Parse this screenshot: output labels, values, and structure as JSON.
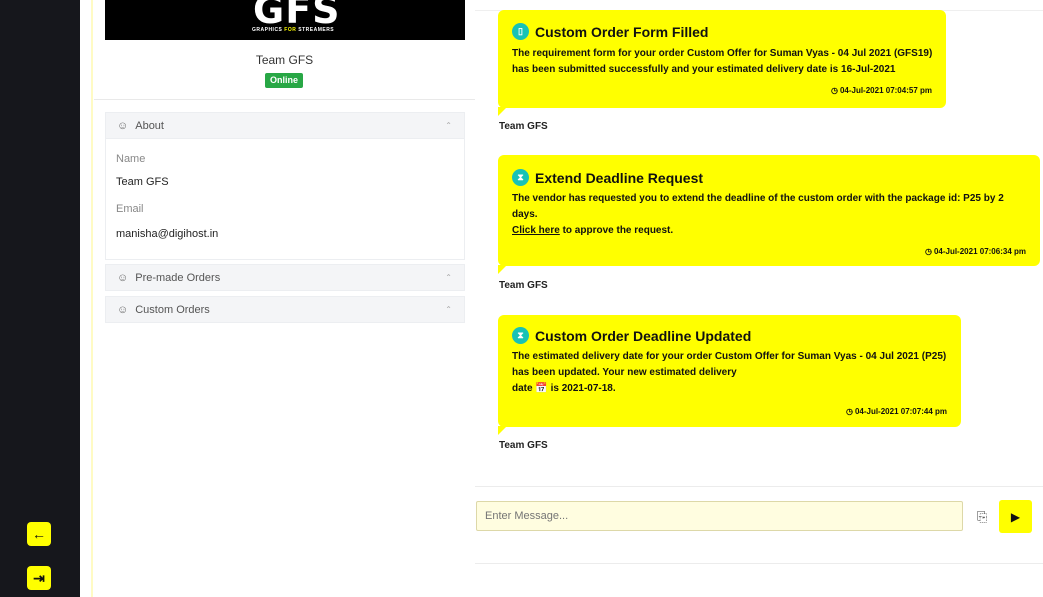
{
  "rail": {
    "back_icon": "arrow-left-icon",
    "logout_icon": "logout-icon"
  },
  "profile": {
    "logo_text": "GFS",
    "logo_tagline_1": "GRAPHICS",
    "logo_tagline_2": "FOR",
    "logo_tagline_3": "STREAMERS",
    "name": "Team GFS",
    "status": "Online",
    "status_color": "#28a745",
    "about": {
      "title": "About",
      "name_label": "Name",
      "name_value": "Team GFS",
      "email_label": "Email",
      "email_value": "manisha@digihost.in"
    },
    "premade_title": "Pre-made Orders",
    "custom_title": "Custom Orders"
  },
  "messages": [
    {
      "title": "Custom Order Form Filled",
      "line1": "The requirement form for your order Custom Offer for Suman Vyas - 04 Jul 2021 (GFS19)",
      "line2": "has been submitted successfully and your estimated delivery date is 16-Jul-2021",
      "time": "04-Jul-2021 07:04:57 pm",
      "sender": "Team GFS"
    },
    {
      "title": "Extend Deadline Request",
      "line1": "The vendor has requested you to extend the deadline of the custom order with the package id: P25 by 2",
      "line2": "days.",
      "link_text": "Click here",
      "line3": " to approve the request.",
      "time": "04-Jul-2021 07:06:34 pm",
      "sender": "Team GFS"
    },
    {
      "title": "Custom Order Deadline Updated",
      "line1": "The estimated delivery date for your order Custom Offer for Suman Vyas - 04 Jul 2021 (P25)",
      "line2": "has been updated. Your new estimated delivery",
      "line3a": "date ",
      "line3b": " is 2021-07-18.",
      "time": "04-Jul-2021 07:07:44 pm",
      "sender": "Team GFS"
    }
  ],
  "composer": {
    "placeholder": "Enter Message...",
    "attach_icon": "paperclip-icon",
    "send_icon": "send-icon"
  },
  "colors": {
    "accent": "#ffff00",
    "rail": "#16171c"
  }
}
